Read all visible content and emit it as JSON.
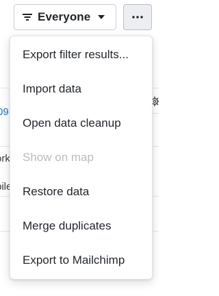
{
  "toolbar": {
    "filter_label": "Everyone",
    "filter_icon": "filter-lines-icon",
    "filter_caret_icon": "caret-down-icon",
    "more_icon": "ellipsis-icon"
  },
  "background_rows": {
    "row1_link": "09",
    "row2_text": "ork",
    "row3_text": "bile"
  },
  "menu": {
    "items": [
      {
        "label": "Export filter results...",
        "enabled": true
      },
      {
        "label": "Import data",
        "enabled": true
      },
      {
        "label": "Open data cleanup",
        "enabled": true
      },
      {
        "label": "Show on map",
        "enabled": false
      },
      {
        "label": "Restore data",
        "enabled": true
      },
      {
        "label": "Merge duplicates",
        "enabled": true
      },
      {
        "label": "Export to Mailchimp",
        "enabled": true
      }
    ]
  },
  "colors": {
    "link": "#1f6fd1",
    "disabled_text": "#b9bcc1",
    "more_button_bg": "#eceef1"
  }
}
